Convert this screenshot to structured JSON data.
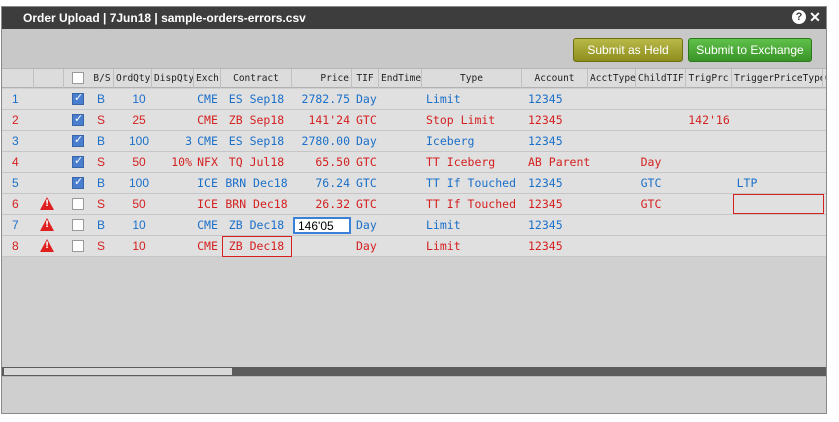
{
  "window": {
    "title": "Order Upload | 7Jun18 | sample-orders-errors.csv",
    "help_glyph": "?",
    "close_glyph": "✕"
  },
  "toolbar": {
    "submit_held_label": "Submit as Held",
    "submit_exchange_label": "Submit to Exchange"
  },
  "columns": [
    {
      "key": "bs",
      "label": "B/S"
    },
    {
      "key": "ordqty",
      "label": "OrdQty"
    },
    {
      "key": "dispqty",
      "label": "DispQty"
    },
    {
      "key": "exch",
      "label": "Exch"
    },
    {
      "key": "contract",
      "label": "Contract"
    },
    {
      "key": "price",
      "label": "Price"
    },
    {
      "key": "tif",
      "label": "TIF"
    },
    {
      "key": "endtime",
      "label": "EndTime"
    },
    {
      "key": "type",
      "label": "Type"
    },
    {
      "key": "account",
      "label": "Account"
    },
    {
      "key": "accttype",
      "label": "AcctType"
    },
    {
      "key": "childtif",
      "label": "ChildTIF"
    },
    {
      "key": "trigprc",
      "label": "TrigPrc"
    },
    {
      "key": "triggerpricetype",
      "label": "TriggerPriceType"
    },
    {
      "key": "extra",
      "label": "O/("
    }
  ],
  "rows": [
    {
      "num": "1",
      "error": false,
      "checked": true,
      "bs": "B",
      "ordqty": "10",
      "dispqty": "",
      "exch": "CME",
      "contract": "ES Sep18",
      "price": "2782.75",
      "tif": "Day",
      "endtime": "",
      "type": "Limit",
      "account": "12345",
      "accttype": "",
      "childtif": "",
      "trigprc": "",
      "triggerpricetype": "",
      "color": "blue"
    },
    {
      "num": "2",
      "error": false,
      "checked": true,
      "bs": "S",
      "ordqty": "25",
      "dispqty": "",
      "exch": "CME",
      "contract": "ZB Sep18",
      "price": "141'24",
      "tif": "GTC",
      "endtime": "",
      "type": "Stop Limit",
      "account": "12345",
      "accttype": "",
      "childtif": "",
      "trigprc": "142'16",
      "triggerpricetype": "",
      "color": "red"
    },
    {
      "num": "3",
      "error": false,
      "checked": true,
      "bs": "B",
      "ordqty": "100",
      "dispqty": "3",
      "exch": "CME",
      "contract": "ES Sep18",
      "price": "2780.00",
      "tif": "Day",
      "endtime": "",
      "type": "Iceberg",
      "account": "12345",
      "accttype": "",
      "childtif": "",
      "trigprc": "",
      "triggerpricetype": "",
      "color": "blue"
    },
    {
      "num": "4",
      "error": false,
      "checked": true,
      "bs": "S",
      "ordqty": "50",
      "dispqty": "10%",
      "exch": "NFX",
      "contract": "TQ Jul18",
      "price": "65.50",
      "tif": "GTC",
      "endtime": "",
      "type": "TT Iceberg",
      "account": "AB Parent",
      "accttype": "",
      "childtif": "Day",
      "trigprc": "",
      "triggerpricetype": "",
      "color": "red"
    },
    {
      "num": "5",
      "error": false,
      "checked": true,
      "bs": "B",
      "ordqty": "100",
      "dispqty": "",
      "exch": "ICE",
      "contract": "BRN Dec18",
      "price": "76.24",
      "tif": "GTC",
      "endtime": "",
      "type": "TT If Touched",
      "account": "12345",
      "accttype": "",
      "childtif": "GTC",
      "trigprc": "",
      "triggerpricetype": "LTP",
      "color": "blue"
    },
    {
      "num": "6",
      "error": true,
      "checked": false,
      "bs": "S",
      "ordqty": "50",
      "dispqty": "",
      "exch": "ICE",
      "contract": "BRN Dec18",
      "price": "26.32",
      "tif": "GTC",
      "endtime": "",
      "type": "TT If Touched",
      "account": "12345",
      "accttype": "",
      "childtif": "GTC",
      "trigprc": "",
      "triggerpricetype": "",
      "color": "red"
    },
    {
      "num": "7",
      "error": true,
      "checked": false,
      "bs": "B",
      "ordqty": "10",
      "dispqty": "",
      "exch": "CME",
      "contract": "ZB Dec18",
      "price": "",
      "tif": "Day",
      "endtime": "",
      "type": "Limit",
      "account": "12345",
      "accttype": "",
      "childtif": "",
      "trigprc": "",
      "triggerpricetype": "",
      "color": "blue"
    },
    {
      "num": "8",
      "error": true,
      "checked": false,
      "bs": "S",
      "ordqty": "10",
      "dispqty": "",
      "exch": "CME",
      "contract": "ZB Dec18",
      "price": "",
      "tif": "Day",
      "endtime": "",
      "type": "Limit",
      "account": "12345",
      "accttype": "",
      "childtif": "",
      "trigprc": "",
      "triggerpricetype": "",
      "color": "red"
    }
  ],
  "editing": {
    "row": "7",
    "column": "price",
    "value": "146'05"
  },
  "colors": {
    "buy": "#1a6fc9",
    "sell": "#d42020",
    "error": "#d42020",
    "submit_held": "#a3a333",
    "submit_exchange": "#4aa838"
  }
}
